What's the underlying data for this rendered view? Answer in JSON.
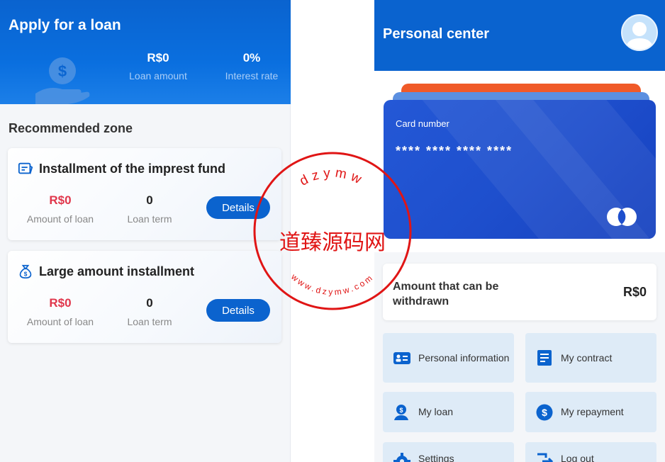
{
  "loan": {
    "title": "Apply for a loan",
    "amount_value": "R$0",
    "amount_label": "Loan amount",
    "rate_value": "0%",
    "rate_label": "Interest rate"
  },
  "recommended": {
    "title": "Recommended zone",
    "cards": [
      {
        "title": "Installment of the imprest fund",
        "icon": "card-icon",
        "amount": "R$0",
        "amount_label": "Amount of loan",
        "term": "0",
        "term_label": "Loan term",
        "button": "Details"
      },
      {
        "title": "Large amount installment",
        "icon": "money-bag-icon",
        "amount": "R$0",
        "amount_label": "Amount of loan",
        "term": "0",
        "term_label": "Loan term",
        "button": "Details"
      }
    ]
  },
  "personal": {
    "title": "Personal center",
    "card_label": "Card number",
    "card_number": "**** **** **** ****",
    "withdraw_label": "Amount that can be withdrawn",
    "withdraw_value": "R$0",
    "menu": [
      {
        "label": "Personal information",
        "icon": "id-card-icon"
      },
      {
        "label": "My contract",
        "icon": "contract-icon"
      },
      {
        "label": "My loan",
        "icon": "user-loan-icon"
      },
      {
        "label": "My repayment",
        "icon": "dollar-icon"
      },
      {
        "label": "Settings",
        "icon": "gear-icon"
      },
      {
        "label": "Log out",
        "icon": "logout-icon"
      }
    ]
  },
  "watermark": {
    "top_text": "dzymw",
    "center_text": "道臻源码网",
    "bottom_text": "www.dzymw.com"
  },
  "colors": {
    "primary": "#0a63cf",
    "amount_red": "#e0364b",
    "tile_bg": "#deebf7",
    "watermark": "#e01515"
  }
}
